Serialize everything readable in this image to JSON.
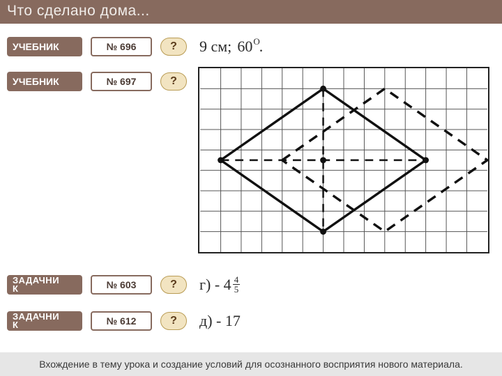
{
  "title": "Что  сделано  дома...",
  "rows": [
    {
      "label": "УЧЕБНИК",
      "num": "№ 696",
      "q": "?",
      "answer": {
        "type": "deg",
        "cm": "9 см;",
        "deg": "60",
        "suffix": "."
      }
    },
    {
      "label": "УЧЕБНИК",
      "num": "№ 697",
      "q": "?",
      "answer": {
        "type": "diagram"
      }
    },
    {
      "label_split": [
        "ЗАДАЧНИ",
        "К"
      ],
      "num": "№ 603",
      "q": "?",
      "answer": {
        "type": "frac",
        "prefix": "г) - 4",
        "frac_num": "4",
        "frac_den": "5"
      }
    },
    {
      "label_split": [
        "ЗАДАЧНИ",
        "К"
      ],
      "num": "№ 612",
      "q": "?",
      "answer": {
        "type": "plain",
        "text": "д) - 17"
      }
    }
  ],
  "footer": "Вхождение в тему урока и создание условий для осознанного восприятия нового материала."
}
